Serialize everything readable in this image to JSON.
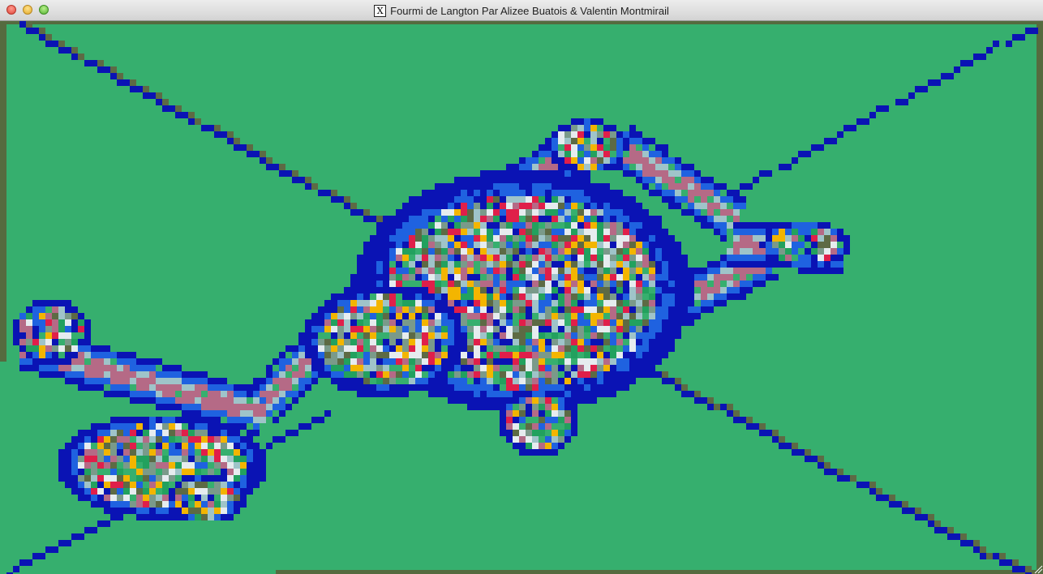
{
  "window": {
    "title": "Fourmi de Langton Par Alizee Buatois & Valentin Montmirail",
    "icon": "x11-icon"
  },
  "canvas": {
    "background": "#36af6e",
    "border_color": "#556b3f",
    "palette": [
      "#0a13b4",
      "#1f62e0",
      "#b56a86",
      "#9fc4c9",
      "#e01f4a",
      "#f3b500",
      "#e6ecef",
      "#5d6a44",
      "#22a15e",
      "#7a9a8a"
    ],
    "ant_trail": "Langton ant multi-color highway"
  }
}
